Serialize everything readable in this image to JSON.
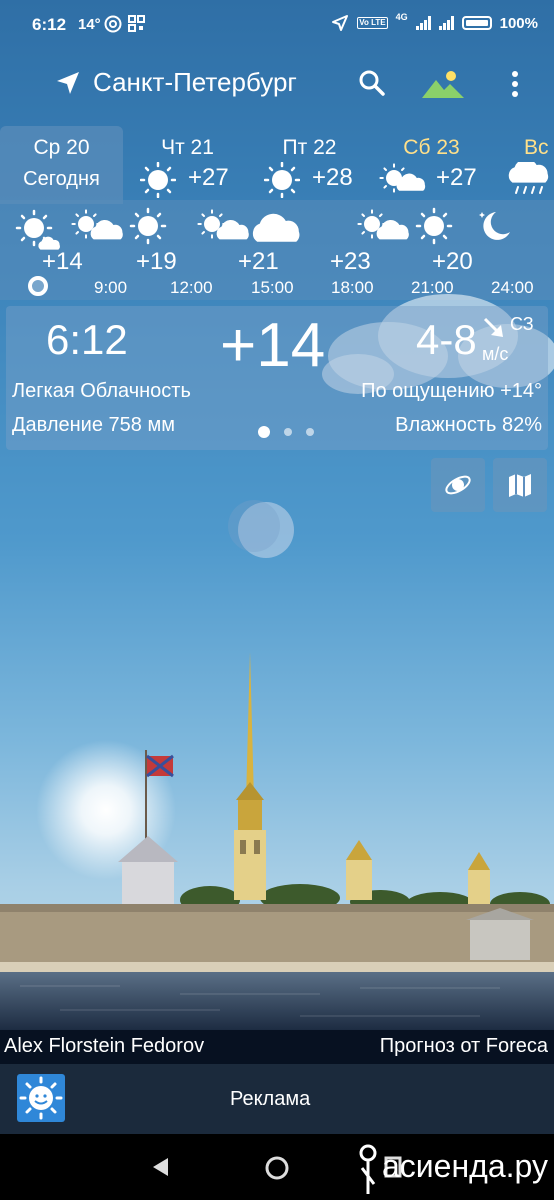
{
  "status_bar": {
    "time": "6:12",
    "temp": "14°",
    "network": "4G",
    "volte": "Vo LTE",
    "battery": "100%"
  },
  "toolbar": {
    "city": "Санкт-Петербург",
    "icons": [
      "location-arrow-icon",
      "search-icon",
      "landscape-icon",
      "more-vert-icon"
    ]
  },
  "days": [
    {
      "name": "Ср 20",
      "sub": "Сегодня",
      "icon": "sun-cloud-icon",
      "temp": ""
    },
    {
      "name": "Чт 21",
      "sub": "",
      "icon": "sun-icon",
      "temp": "+27"
    },
    {
      "name": "Пт 22",
      "sub": "",
      "icon": "sun-icon",
      "temp": "+28"
    },
    {
      "name": "Сб 23",
      "sub": "",
      "icon": "sun-cloud-icon",
      "temp": "+27"
    },
    {
      "name": "Вс",
      "sub": "",
      "icon": "rain-cloud-icon",
      "temp": ""
    }
  ],
  "day_colors": {
    "weekend": "#ffe08a",
    "normal": "#ffffff"
  },
  "hourly": {
    "temps": [
      "+14",
      "+19",
      "+21",
      "+23",
      "+20"
    ],
    "times": [
      "9:00",
      "12:00",
      "15:00",
      "18:00",
      "21:00",
      "24:00"
    ]
  },
  "current": {
    "time": "6:12",
    "temp": "+14",
    "wind": "4-8",
    "wind_dir": "СЗ",
    "wind_unit": "м/с",
    "condition": "Легкая Облачность",
    "feels_like": "По ощущению +14°",
    "pressure": "Давление 758 мм",
    "humidity": "Влажность 82%"
  },
  "footer": {
    "author": "Alex Florstein Fedorov",
    "provider": "Прогноз от Foreca",
    "ad_label": "Реклама",
    "watermark": "асиенда.ру"
  },
  "colors": {
    "sky_top": "#2f6fa6",
    "selected_day_bg": "#5a8cb9",
    "credit_bg": "#071121",
    "ad_bg": "#1b2a3c",
    "sun_yellow": "#ffe066"
  }
}
